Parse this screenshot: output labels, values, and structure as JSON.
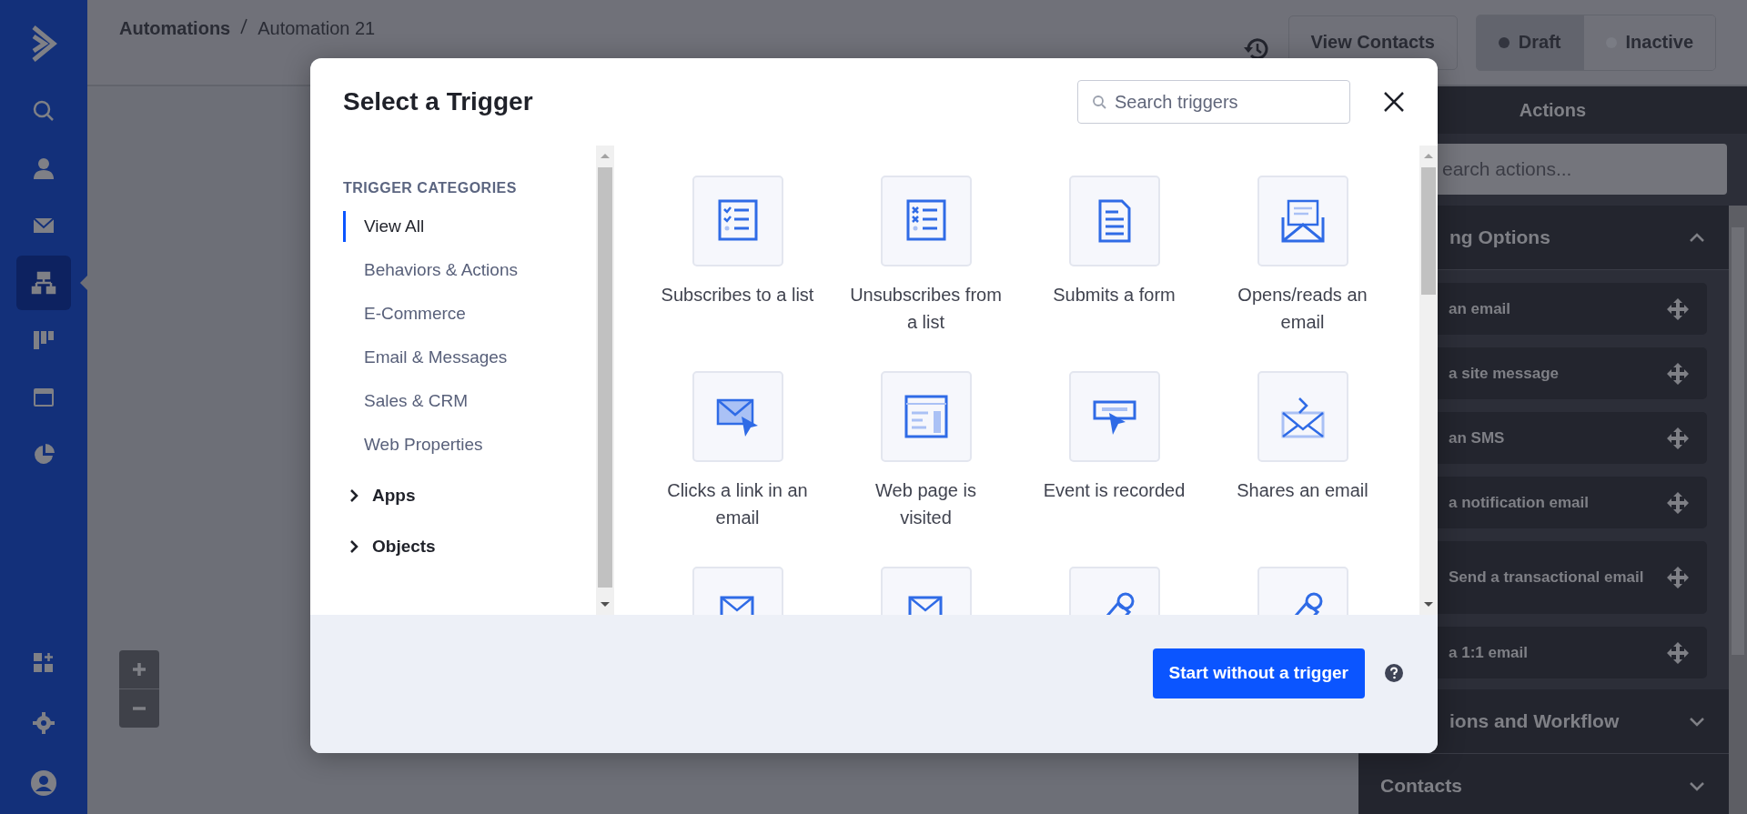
{
  "nav": [
    {
      "kind": "search",
      "selected": false
    },
    {
      "kind": "contacts",
      "selected": false
    },
    {
      "kind": "email",
      "selected": false
    },
    {
      "kind": "automations",
      "selected": true
    },
    {
      "kind": "pipelines",
      "selected": false
    },
    {
      "kind": "website",
      "selected": false
    },
    {
      "kind": "reports",
      "selected": false
    }
  ],
  "nav_bottom": [
    {
      "kind": "apps"
    },
    {
      "kind": "settings"
    },
    {
      "kind": "account"
    }
  ],
  "breadcrumb": [
    "Automations",
    "Automation 21"
  ],
  "topbar": {
    "view_contacts": "View Contacts",
    "status": [
      {
        "label": "Draft",
        "selected": true
      },
      {
        "label": "Inactive",
        "selected": false
      }
    ]
  },
  "actions_panel": {
    "title": "Actions",
    "search": {
      "placeholder": "earch actions..."
    },
    "sections": [
      {
        "title": "ng Options",
        "expanded": true,
        "items": [
          "an email",
          "a site message",
          "an SMS",
          "a notification email",
          "Send a transactional email",
          "a 1:1 email"
        ]
      },
      {
        "title": "ions and Workflow",
        "expanded": false
      },
      {
        "title": "Contacts",
        "expanded": false
      }
    ]
  },
  "modal": {
    "title": "Select a Trigger",
    "search": {
      "placeholder": "Search triggers"
    },
    "categories_heading": "TRIGGER CATEGORIES",
    "categories": [
      {
        "label": "View All",
        "selected": true
      },
      {
        "label": "Behaviors & Actions",
        "selected": false
      },
      {
        "label": "E-Commerce",
        "selected": false
      },
      {
        "label": "Email & Messages",
        "selected": false
      },
      {
        "label": "Sales & CRM",
        "selected": false
      },
      {
        "label": "Web Properties",
        "selected": false
      }
    ],
    "groups": [
      {
        "label": "Apps",
        "expanded": false
      },
      {
        "label": "Objects",
        "expanded": false
      }
    ],
    "triggers": [
      {
        "kind": "subscribe",
        "label": "Subscribes to a list"
      },
      {
        "kind": "unsubscribe",
        "label": "Unsubscribes from a list"
      },
      {
        "kind": "form",
        "label": "Submits a form"
      },
      {
        "kind": "open",
        "label": "Opens/reads an email"
      },
      {
        "kind": "click",
        "label": "Clicks a link in an email"
      },
      {
        "kind": "webpage",
        "label": "Web page is visited"
      },
      {
        "kind": "event",
        "label": "Event is recorded"
      },
      {
        "kind": "share",
        "label": "Shares an email"
      },
      {
        "kind": "forward"
      },
      {
        "kind": "reply"
      },
      {
        "kind": "tag"
      },
      {
        "kind": "tag"
      }
    ],
    "footer_button": "Start without a trigger"
  }
}
